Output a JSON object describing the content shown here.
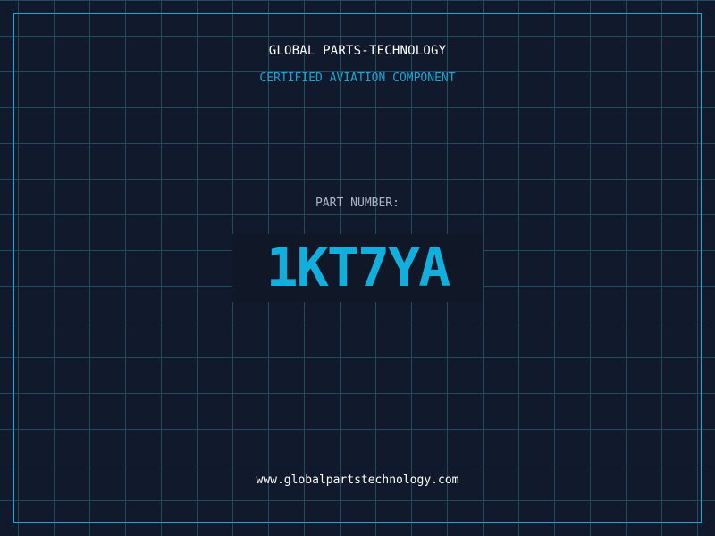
{
  "header": {
    "company_name": "GLOBAL PARTS-TECHNOLOGY",
    "subtitle": "CERTIFIED AVIATION COMPONENT"
  },
  "part": {
    "label": "PART NUMBER:",
    "number": "1KT7YA"
  },
  "footer": {
    "website": "www.globalpartstechnology.com"
  },
  "colors": {
    "background": "#111a2c",
    "grid": "#1f4a60",
    "frame": "#1fa6cc",
    "accent": "#12aedc",
    "label": "#a9b6c4",
    "text": "#ffffff"
  }
}
